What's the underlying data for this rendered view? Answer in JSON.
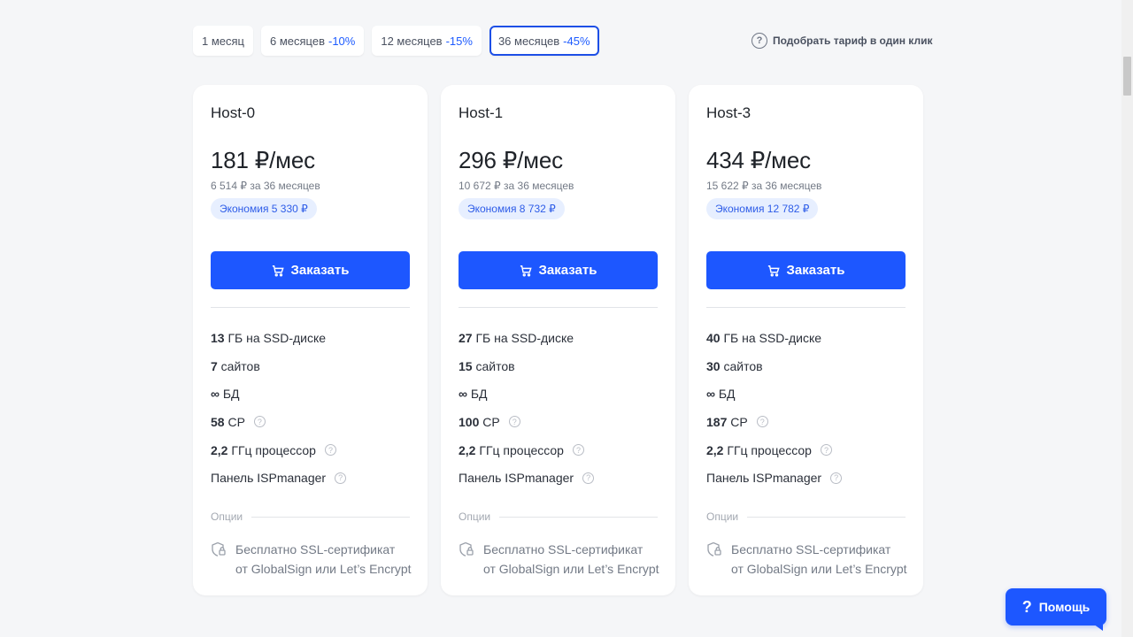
{
  "periods": [
    {
      "label": "1 месяц",
      "discount": ""
    },
    {
      "label": "6 месяцев",
      "discount": "-10%"
    },
    {
      "label": "12 месяцев",
      "discount": "-15%"
    },
    {
      "label": "36 месяцев",
      "discount": "-45%"
    }
  ],
  "active_period": "36 месяцев",
  "picker_label": "Подобрать тариф в один клик",
  "cards": [
    {
      "title": "Host-0",
      "price": "181 ₽/мес",
      "total": "6 514 ₽ за 36 месяцев",
      "savings": "Экономия 5 330 ₽",
      "order_label": "Заказать",
      "features": [
        {
          "value": "13",
          "text": " ГБ на SSD-диске"
        },
        {
          "value": "7",
          "text": " сайтов"
        },
        {
          "value": "∞",
          "text": " БД"
        },
        {
          "value": "58",
          "text": " CP"
        },
        {
          "value": "2,2",
          "text": " ГГц процессор"
        },
        {
          "value": "",
          "text": "Панель ISPmanager"
        }
      ],
      "options_label": "Опции",
      "ssl_text_1": "Бесплатно SSL-сертификат",
      "ssl_text_2": "от GlobalSign или Let’s Encrypt"
    },
    {
      "title": "Host-1",
      "price": "296 ₽/мес",
      "total": "10 672 ₽ за 36 месяцев",
      "savings": "Экономия 8 732 ₽",
      "order_label": "Заказать",
      "features": [
        {
          "value": "27",
          "text": " ГБ на SSD-диске"
        },
        {
          "value": "15",
          "text": " сайтов"
        },
        {
          "value": "∞",
          "text": " БД"
        },
        {
          "value": "100",
          "text": " CP"
        },
        {
          "value": "2,2",
          "text": " ГГц процессор"
        },
        {
          "value": "",
          "text": "Панель ISPmanager"
        }
      ],
      "options_label": "Опции",
      "ssl_text_1": "Бесплатно SSL-сертификат",
      "ssl_text_2": "от GlobalSign или Let’s Encrypt"
    },
    {
      "title": "Host-3",
      "price": "434 ₽/мес",
      "total": "15 622 ₽ за 36 месяцев",
      "savings": "Экономия 12 782 ₽",
      "order_label": "Заказать",
      "features": [
        {
          "value": "40",
          "text": " ГБ на SSD-диске"
        },
        {
          "value": "30",
          "text": " сайтов"
        },
        {
          "value": "∞",
          "text": " БД"
        },
        {
          "value": "187",
          "text": " CP"
        },
        {
          "value": "2,2",
          "text": " ГГц процессор"
        },
        {
          "value": "",
          "text": "Панель ISPmanager"
        }
      ],
      "options_label": "Опции",
      "ssl_text_1": "Бесплатно SSL-сертификат",
      "ssl_text_2": "от GlobalSign или Let’s Encrypt"
    }
  ],
  "help_label": "Помощь",
  "colors": {
    "accent": "#1d57ff",
    "savings_bg": "#e7efff",
    "background": "#f5f6f8"
  }
}
